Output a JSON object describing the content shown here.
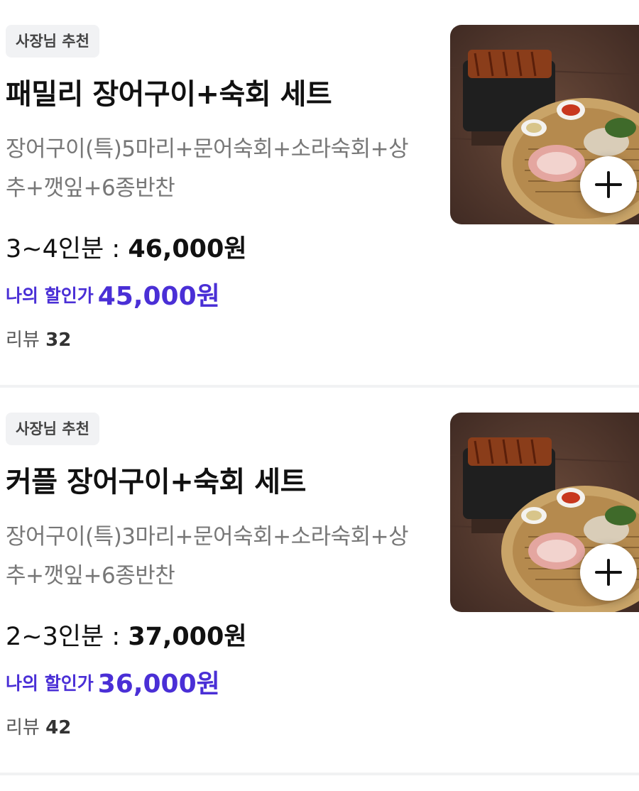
{
  "menu_items": [
    {
      "badge": "사장님 추천",
      "name": "패밀리 장어구이+숙회 세트",
      "description": "장어구이(특)5마리+문어숙회+소라숙회+상추+깻잎+6종반찬",
      "serving": "3~4인분 : ",
      "price": "46,000원",
      "discount_label": "나의 할인가",
      "discount_price": "45,000원",
      "review_label": "리뷰",
      "review_count": "32",
      "image_icon": "grilled-eel-platter-photo",
      "add_icon": "plus-icon"
    },
    {
      "badge": "사장님 추천",
      "name": "커플 장어구이+숙회 세트",
      "description": "장어구이(특)3마리+문어숙회+소라숙회+상추+깻잎+6종반찬",
      "serving": "2~3인분 : ",
      "price": "37,000원",
      "discount_label": "나의 할인가",
      "discount_price": "36,000원",
      "review_label": "리뷰",
      "review_count": "42",
      "image_icon": "grilled-eel-platter-photo",
      "add_icon": "plus-icon"
    }
  ],
  "colors": {
    "discount": "#4a2fd6",
    "badge_bg": "#f1f2f4",
    "description": "#777777"
  }
}
